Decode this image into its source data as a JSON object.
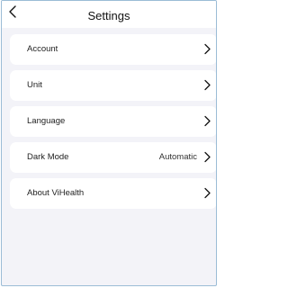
{
  "header": {
    "title": "Settings",
    "back_icon": "chevron-left-icon"
  },
  "settings": {
    "items": [
      {
        "label": "Account",
        "value": "",
        "icon": "chevron-right-icon"
      },
      {
        "label": "Unit",
        "value": "",
        "icon": "chevron-right-icon"
      },
      {
        "label": "Language",
        "value": "",
        "icon": "chevron-right-icon"
      },
      {
        "label": "Dark Mode",
        "value": "Automatic",
        "icon": "chevron-right-icon"
      },
      {
        "label": "About ViHealth",
        "value": "",
        "icon": "chevron-right-icon"
      }
    ]
  },
  "colors": {
    "background": "#f3f3f8",
    "card": "#ffffff",
    "border": "#9bbcd6"
  }
}
